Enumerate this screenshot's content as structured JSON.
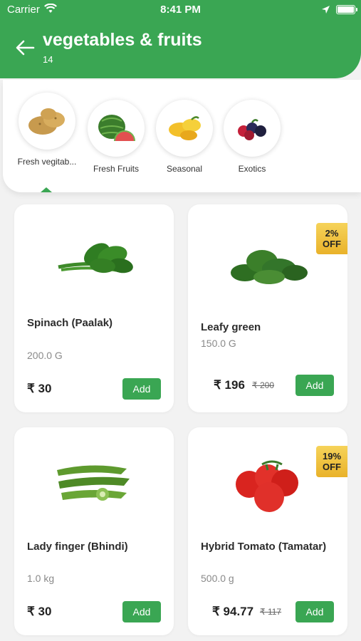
{
  "status_bar": {
    "carrier": "Carrier",
    "time": "8:41 PM"
  },
  "header": {
    "title": "vegetables & fruits",
    "count": "14"
  },
  "categories": [
    {
      "label": "Fresh vegitab...",
      "icon": "potato-icon",
      "selected": true
    },
    {
      "label": "Fresh Fruits",
      "icon": "watermelon-icon",
      "selected": false
    },
    {
      "label": "Seasonal",
      "icon": "mango-icon",
      "selected": false
    },
    {
      "label": "Exotics",
      "icon": "berries-icon",
      "selected": false
    }
  ],
  "products": [
    {
      "name": "Spinach (Paalak)",
      "quantity": "200.0 G",
      "price": "₹ 30",
      "mrp": "",
      "discount": "",
      "add_label": "Add",
      "image": "spinach-image"
    },
    {
      "name": "Leafy green",
      "quantity": "150.0 G",
      "price": "₹ 196",
      "mrp": "₹ 200",
      "discount": "2% OFF",
      "add_label": "Add",
      "image": "leafy-green-image"
    },
    {
      "name": "Lady finger (Bhindi)",
      "quantity": "1.0 kg",
      "price": "₹ 30",
      "mrp": "",
      "discount": "",
      "add_label": "Add",
      "image": "lady-finger-image"
    },
    {
      "name": "Hybrid Tomato (Tamatar)",
      "quantity": "500.0 g",
      "price": "₹ 94.77",
      "mrp": "₹ 117",
      "discount": "19% OFF",
      "add_label": "Add",
      "image": "tomato-image"
    }
  ],
  "colors": {
    "brand_green": "#3aa653",
    "badge_yellow": "#f0c23c"
  }
}
